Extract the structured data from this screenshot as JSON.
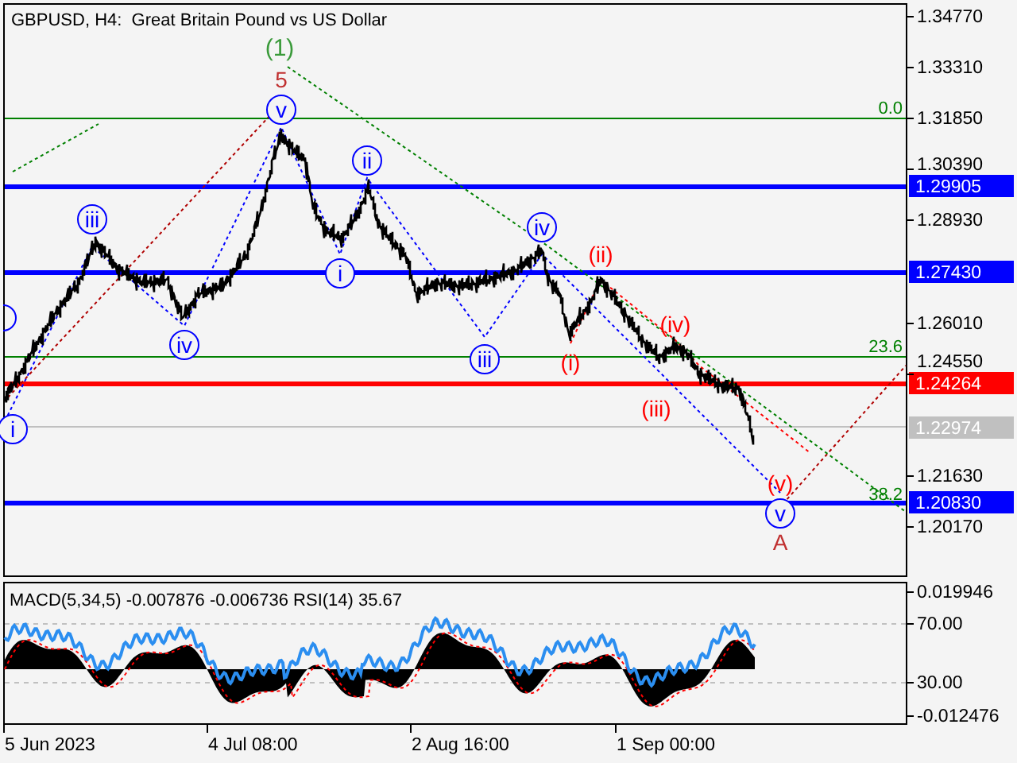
{
  "title": "GBPUSD, H4:  Great Britain Pound vs US Dollar",
  "price_axis": [
    "1.34770",
    "1.33310",
    "1.31850",
    "1.30390",
    "1.28930",
    "1.26010",
    "1.24550",
    "1.21630",
    "1.20170"
  ],
  "levels": [
    {
      "label": "1.29905",
      "color": "#0000ff"
    },
    {
      "label": "1.27430",
      "color": "#0000ff"
    },
    {
      "label": "1.24264",
      "color": "#ff0000"
    },
    {
      "label": "1.22974",
      "color": "#c0c0c0"
    },
    {
      "label": "1.20830",
      "color": "#0000ff"
    }
  ],
  "fib_levels": [
    "0.0",
    "23.6",
    "38.2"
  ],
  "wave_labels": [
    {
      "text": "(1)",
      "kind": "degree"
    },
    {
      "text": "5",
      "kind": "minor"
    },
    {
      "text": "iii",
      "kind": "circled"
    },
    {
      "text": "iv",
      "kind": "circled"
    },
    {
      "text": "v",
      "kind": "circled"
    },
    {
      "text": "ii",
      "kind": "circled"
    },
    {
      "text": "i",
      "kind": "circled"
    },
    {
      "text": "iii",
      "kind": "circled"
    },
    {
      "text": "iv",
      "kind": "circled"
    },
    {
      "text": "i",
      "kind": "circled"
    },
    {
      "text": "(ii)",
      "kind": "paren"
    },
    {
      "text": "(iv)",
      "kind": "paren"
    },
    {
      "text": "(i)",
      "kind": "paren"
    },
    {
      "text": "(iii)",
      "kind": "paren"
    },
    {
      "text": "(v)",
      "kind": "paren"
    },
    {
      "text": "v",
      "kind": "circled"
    },
    {
      "text": "A",
      "kind": "minor"
    }
  ],
  "indicator": {
    "header": "MACD(5,34,5) -0.007876 -0.006736 RSI(14) 35.67",
    "axis": [
      "0.019946",
      "70.00",
      "30.00",
      "-0.012476"
    ]
  },
  "time_axis": [
    "5 Jun 2023",
    "4 Jul 08:00",
    "2 Aug 16:00",
    "1 Sep 00:00"
  ]
}
